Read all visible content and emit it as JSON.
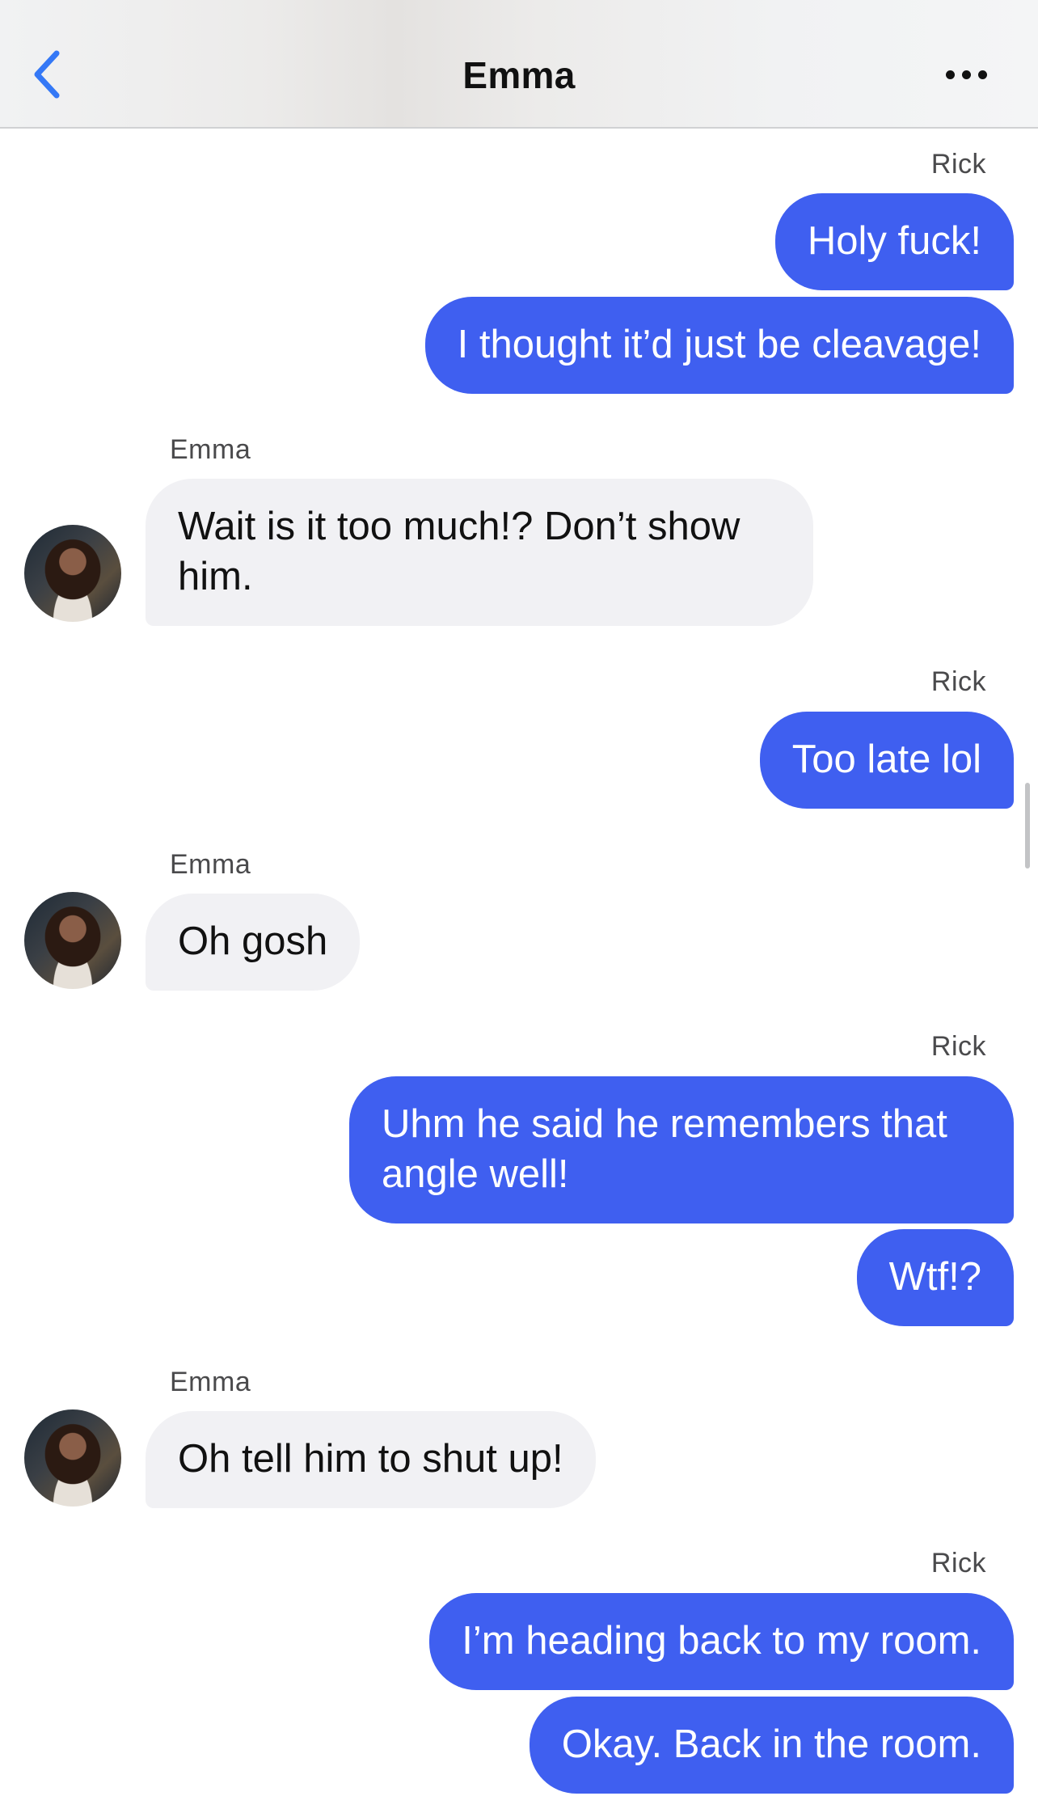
{
  "header": {
    "title": "Emma",
    "back_icon": "chevron-left-icon",
    "more_icon": "ellipsis-icon",
    "accent_color": "#3478f6"
  },
  "colors": {
    "outgoing_bubble": "#3f5ff0",
    "incoming_bubble": "#f1f1f4"
  },
  "messages": [
    {
      "sender": "Rick",
      "text": "Holy fuck!",
      "direction": "outgoing"
    },
    {
      "sender": "Rick",
      "text": "I thought it’d just be cleavage!",
      "direction": "outgoing"
    },
    {
      "sender": "Emma",
      "text": "Wait is it too much!? Don’t show him.",
      "direction": "incoming"
    },
    {
      "sender": "Rick",
      "text": "Too late lol",
      "direction": "outgoing"
    },
    {
      "sender": "Emma",
      "text": "Oh gosh",
      "direction": "incoming"
    },
    {
      "sender": "Rick",
      "text": "Uhm he said he remembers that angle well!",
      "direction": "outgoing"
    },
    {
      "sender": "Rick",
      "text": "Wtf!?",
      "direction": "outgoing"
    },
    {
      "sender": "Emma",
      "text": "Oh tell him to shut up!",
      "direction": "incoming"
    },
    {
      "sender": "Rick",
      "text": "I’m heading back to my room.",
      "direction": "outgoing"
    },
    {
      "sender": "Rick",
      "text": "Okay. Back in the room.",
      "direction": "outgoing"
    }
  ]
}
